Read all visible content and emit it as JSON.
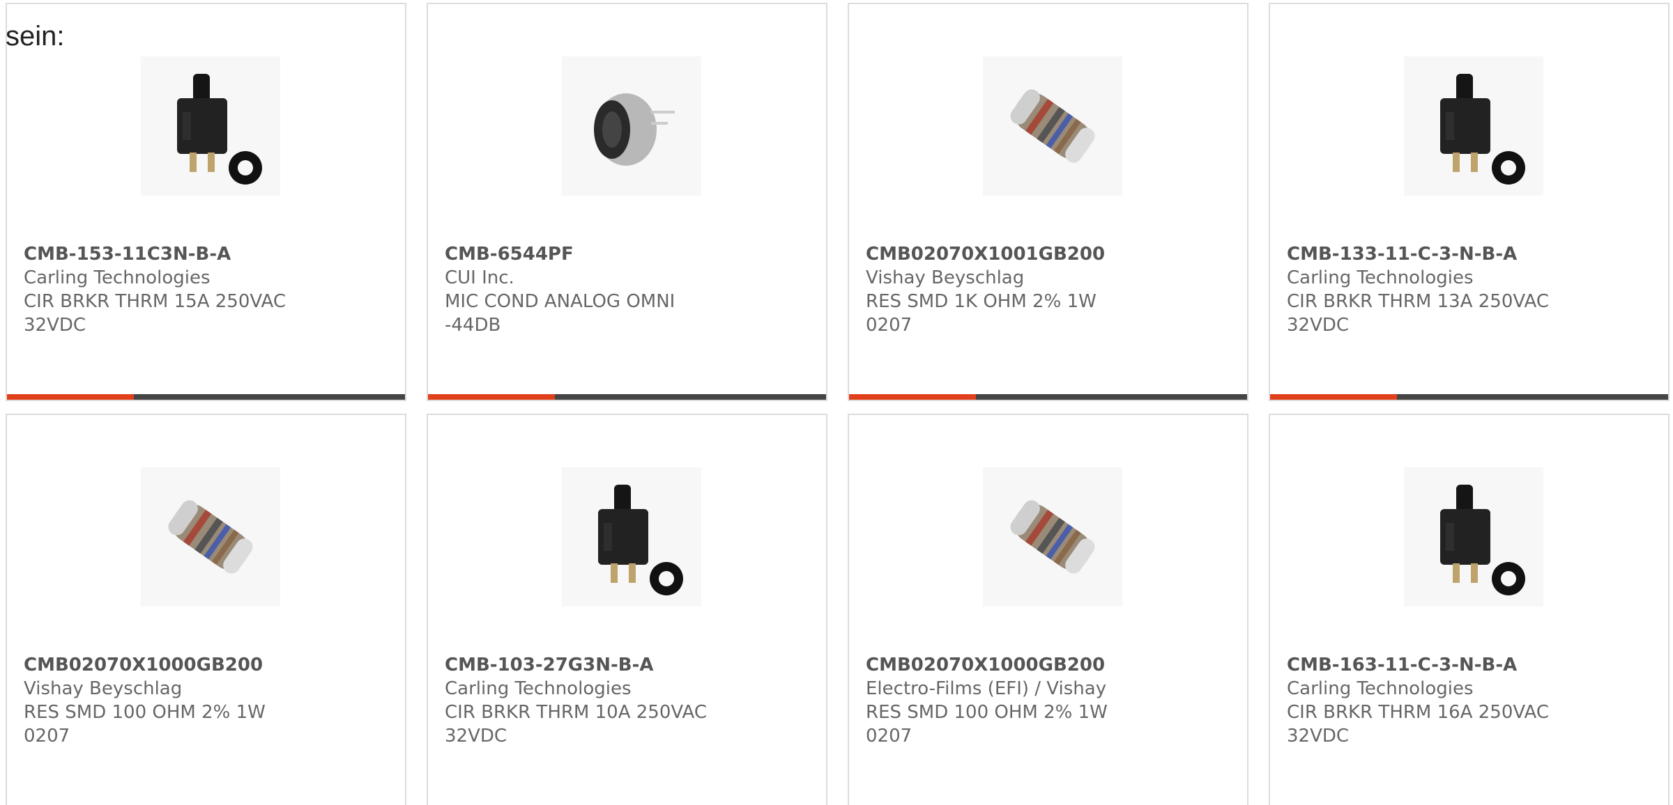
{
  "intro_text": "sein:",
  "colors": {
    "accent": "#e0401c",
    "bar": "#454545",
    "border": "#dcdcdc"
  },
  "products": [
    {
      "part_number": "CMB-153-11C3N-B-A",
      "manufacturer": "Carling Technologies",
      "description": "CIR BRKR THRM 15A 250VAC 32VDC",
      "image_icon": "circuit-breaker-icon"
    },
    {
      "part_number": "CMB-6544PF",
      "manufacturer": "CUI Inc.",
      "description": "MIC COND ANALOG OMNI -44DB",
      "image_icon": "microphone-icon"
    },
    {
      "part_number": "CMB02070X1001GB200",
      "manufacturer": "Vishay Beyschlag",
      "description": "RES SMD 1K OHM 2% 1W 0207",
      "image_icon": "resistor-icon"
    },
    {
      "part_number": "CMB-133-11-C-3-N-B-A",
      "manufacturer": "Carling Technologies",
      "description": "CIR BRKR THRM 13A 250VAC 32VDC",
      "image_icon": "circuit-breaker-icon"
    },
    {
      "part_number": "CMB02070X1000GB200",
      "manufacturer": "Vishay Beyschlag",
      "description": "RES SMD 100 OHM 2% 1W 0207",
      "image_icon": "resistor-icon"
    },
    {
      "part_number": "CMB-103-27G3N-B-A",
      "manufacturer": "Carling Technologies",
      "description": "CIR BRKR THRM 10A 250VAC 32VDC",
      "image_icon": "circuit-breaker-icon"
    },
    {
      "part_number": "CMB02070X1000GB200",
      "manufacturer": "Electro-Films (EFI) / Vishay",
      "description": "RES SMD 100 OHM 2% 1W 0207",
      "image_icon": "resistor-icon"
    },
    {
      "part_number": "CMB-163-11-C-3-N-B-A",
      "manufacturer": "Carling Technologies",
      "description": "CIR BRKR THRM 16A 250VAC 32VDC",
      "image_icon": "circuit-breaker-icon"
    }
  ]
}
